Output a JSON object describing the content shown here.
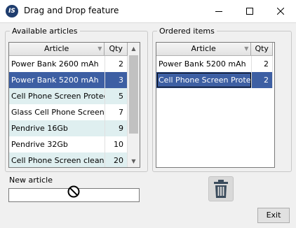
{
  "window": {
    "title": "Drag and Drop feature",
    "app_icon_text": "IS"
  },
  "available": {
    "legend": "Available articles",
    "columns": {
      "article": "Article",
      "qty": "Qty"
    },
    "rows": [
      {
        "article": "Power Bank 2600 mAh",
        "qty": "2"
      },
      {
        "article": "Power Bank 5200 mAh",
        "qty": "3"
      },
      {
        "article": "Cell Phone Screen Protector",
        "qty": "5"
      },
      {
        "article": "Glass Cell Phone Screen Protector",
        "qty": "7"
      },
      {
        "article": "Pendrive 16Gb",
        "qty": "9"
      },
      {
        "article": "Pendrive 32Gb",
        "qty": "10"
      },
      {
        "article": "Cell Phone Screen cleaner",
        "qty": "20"
      }
    ],
    "selected_row": 1
  },
  "ordered": {
    "legend": "Ordered items",
    "columns": {
      "article": "Article",
      "qty": "Qty"
    },
    "rows": [
      {
        "article": "Power Bank 5200 mAh",
        "qty": "2"
      },
      {
        "article": "Cell Phone Screen Protector",
        "qty": "2"
      }
    ],
    "selected_row": 1
  },
  "new_article": {
    "label": "New article",
    "value": ""
  },
  "trash_icon": "trash-icon",
  "exit_label": "Exit",
  "colors": {
    "selection": "#3d5fa3",
    "alt_row": "#dfeff0",
    "trash": "#3a4b5c"
  }
}
